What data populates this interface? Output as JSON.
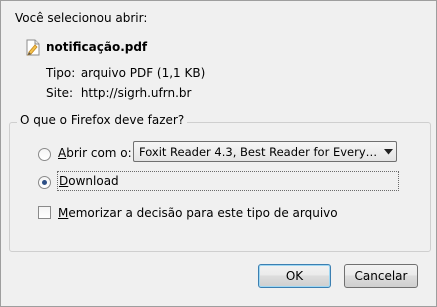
{
  "dialog": {
    "intro": "Você selecionou abrir:",
    "file_name": "notificação.pdf",
    "type_label": "Tipo:",
    "type_value": "arquivo PDF (1,1 KB)",
    "site_label": "Site:",
    "site_value": "http://sigrh.ufrn.br"
  },
  "action_group": {
    "legend": "O que o Firefox deve fazer?",
    "open_with": {
      "label_accel": "A",
      "label_rest": "brir com o:",
      "selected": false
    },
    "app_select": {
      "value": "Foxit Reader 4.3, Best Reader for Everyday U..."
    },
    "download": {
      "label_accel": "D",
      "label_rest": "ownload",
      "selected": true
    },
    "remember": {
      "label_accel": "M",
      "label_rest": "emorizar a decisão para este tipo de arquivo",
      "checked": false
    }
  },
  "buttons": {
    "ok": "OK",
    "cancel": "Cancelar"
  },
  "colors": {
    "window_bg": "#f0f0f0",
    "radio_dot": "#2d4f86"
  },
  "icons": {
    "file": "pdf-document-icon",
    "dropdown": "chevron-down-icon"
  }
}
